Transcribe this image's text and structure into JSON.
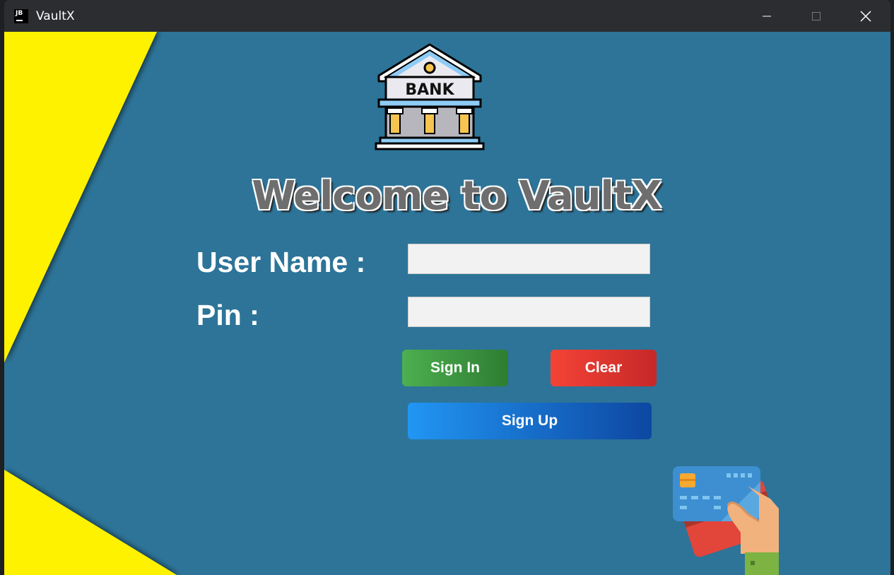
{
  "window": {
    "title": "VaultX",
    "icon": "jb-app-icon",
    "logo_text": "JB"
  },
  "header": {
    "logo_text": "BANK",
    "welcome": "Welcome to VaultX"
  },
  "form": {
    "username_label": "User Name :",
    "username_value": "",
    "pin_label": "Pin :",
    "pin_value": ""
  },
  "buttons": {
    "sign_in": "Sign In",
    "clear": "Clear",
    "sign_up": "Sign Up"
  },
  "colors": {
    "background": "#2d7498",
    "accent_yellow": "#fff200",
    "sign_in": "#43a047",
    "clear": "#e53935",
    "sign_up": "#1e88e5"
  }
}
